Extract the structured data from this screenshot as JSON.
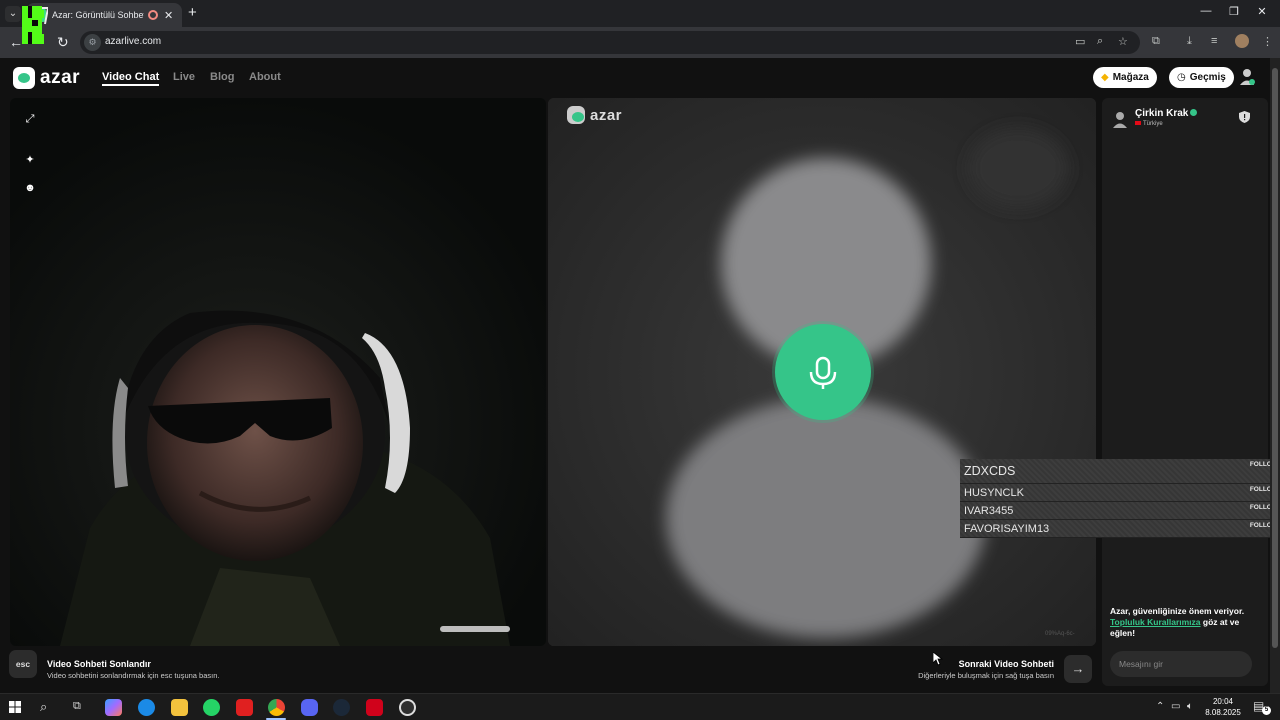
{
  "browser": {
    "tab_title": "Azar: Görüntülü Sohbet, Ar",
    "tab_close": "✕",
    "new_tab": "+",
    "url": "azarlive.com",
    "window_controls": {
      "minimize": "—",
      "maximize": "❐",
      "close": "✕"
    }
  },
  "azar": {
    "logo_text": "azar",
    "nav": {
      "video_chat": "Video Chat",
      "live": "Live",
      "blog": "Blog",
      "about": "About"
    },
    "shop_label": "Mağaza",
    "history_label": "Geçmiş",
    "remote_logo_text": "azar",
    "remote_id": "09%Aq-6c-"
  },
  "chat": {
    "partner_name": "Çirkin Krak",
    "partner_country": "Türkiye",
    "safety_prefix": "Azar, güvenliğinize önem veriyor.",
    "safety_link": "Topluluk Kurallarımıza",
    "safety_suffix": " göz at ve eğlen!",
    "message_placeholder": "Mesajını gir"
  },
  "follow_list": {
    "follow_label": "FOLLOW",
    "items": [
      {
        "name": "ZDXCDS"
      },
      {
        "name": "HUSYNCLK"
      },
      {
        "name": "IVAR3455"
      },
      {
        "name": "FAVORISAYIM13"
      }
    ]
  },
  "bottom_bar": {
    "esc_key": "esc",
    "end_title": "Video Sohbeti Sonlandır",
    "end_desc": "Video sohbetini sonlandırmak için esc tuşuna basın.",
    "next_title": "Sonraki Video Sohbeti",
    "next_desc": "Diğerleriyle buluşmak için sağ tuşa basın",
    "next_arrow": "→"
  },
  "taskbar": {
    "time": "20:04",
    "date": "8.08.2025",
    "notifications": "5"
  },
  "colors": {
    "accent_green": "#35c589",
    "page_bg": "#111111",
    "browser_bg": "#202124"
  }
}
